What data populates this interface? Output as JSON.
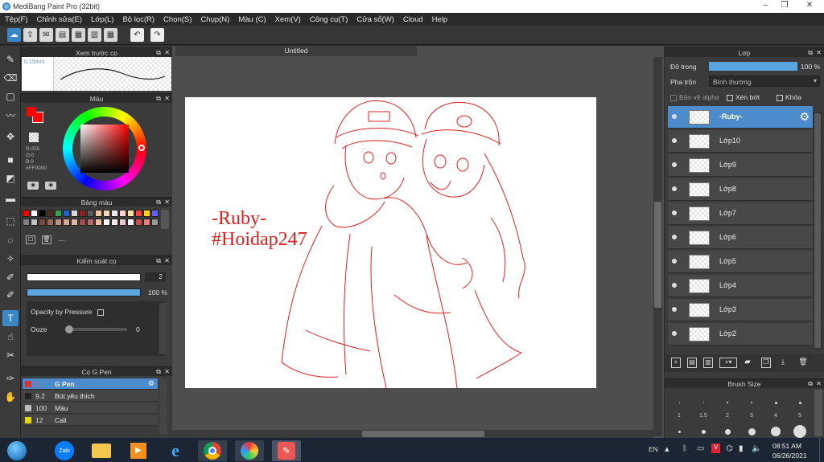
{
  "window": {
    "title": "MediBang Paint Pro (32bit)"
  },
  "menu": [
    "Tệp(F)",
    "Chỉnh sửa(E)",
    "Lớp(L)",
    "Bộ lọc(R)",
    "Chọn(S)",
    "Chụp(N)",
    "Màu (C)",
    "Xem(V)",
    "Công cụ(T)",
    "Cửa sổ(W)",
    "Cloud",
    "Help"
  ],
  "brush_preview": {
    "title": "Xem trước cọ",
    "size": "0.15mm"
  },
  "color": {
    "title": "Màu",
    "r": "R:255",
    "g": "G:0",
    "b": "B:0",
    "hex": "#FF0000",
    "primary": "#ff0000"
  },
  "palette": {
    "title": "Bảng màu",
    "swatches": [
      "#ff0000",
      "#ffffff",
      "#000000",
      "#4b2f1f",
      "#38a34f",
      "#1f64c8",
      "#d8d8d8",
      "#8c1f1f",
      "#5a5a5a",
      "#f0c8a0",
      "#f5d6b5",
      "#eee",
      "#ffd0d0",
      "#ffe0a0",
      "#ff4040",
      "#ffd200",
      "#6060ff",
      "#808080",
      "#c0c0c0",
      "#7a4a3a",
      "#9a6a5a",
      "#bf8f7f",
      "#d5a595",
      "#deb8a8",
      "#a05050",
      "#b06a6a",
      "#f2c0a0",
      "#fff",
      "#ffe8e8",
      "#e6c8c8",
      "#fafafa",
      "#c85050",
      "#e88080",
      "#999"
    ],
    "footer": "---"
  },
  "brush_control": {
    "title": "Kiểm soát cọ",
    "size": "2",
    "opacity": "100 %",
    "opacity_level": 1.0,
    "opacity_by_pressure": "Opacity by Pressure",
    "ooze_label": "Ooze",
    "ooze_value": "0"
  },
  "brushes": {
    "title": "Cọ G Pen",
    "items": [
      {
        "size": "2",
        "name": "G Pen",
        "color": "#e03030"
      },
      {
        "size": "9.2",
        "name": "Bút yêu thích",
        "color": "#222222"
      },
      {
        "size": "100",
        "name": "Màu",
        "color": "#bbbbbb"
      },
      {
        "size": "12",
        "name": "Cali",
        "color": "#e8d800"
      }
    ]
  },
  "document": {
    "tab_title": "Untitled"
  },
  "artwork": {
    "line1": "-Ruby-",
    "line2": "#Hoidap247",
    "stroke_color": "#e02020"
  },
  "layers_panel": {
    "title": "Lớp",
    "opacity_label": "Độ trong",
    "opacity_value": "100 %",
    "opacity_level": 1.0,
    "blend_label": "Pha trộn",
    "blend_value": "Bình thường",
    "protect_alpha": "Bảo vệ alpha",
    "clipping": "Xén bớt",
    "lock": "Khóa",
    "layers": [
      "-Ruby-",
      "Lớp10",
      "Lớp9",
      "Lớp8",
      "Lớp7",
      "Lớp6",
      "Lớp5",
      "Lớp4",
      "Lớp3",
      "Lớp2"
    ]
  },
  "brush_size_panel": {
    "title": "Brush Size",
    "labels": [
      "1",
      "1.5",
      "2",
      "3",
      "4",
      "5"
    ]
  },
  "taskbar": {
    "lang": "EN",
    "time": "08:51 AM",
    "date": "06/26/2021",
    "zalo": "Zalo"
  }
}
